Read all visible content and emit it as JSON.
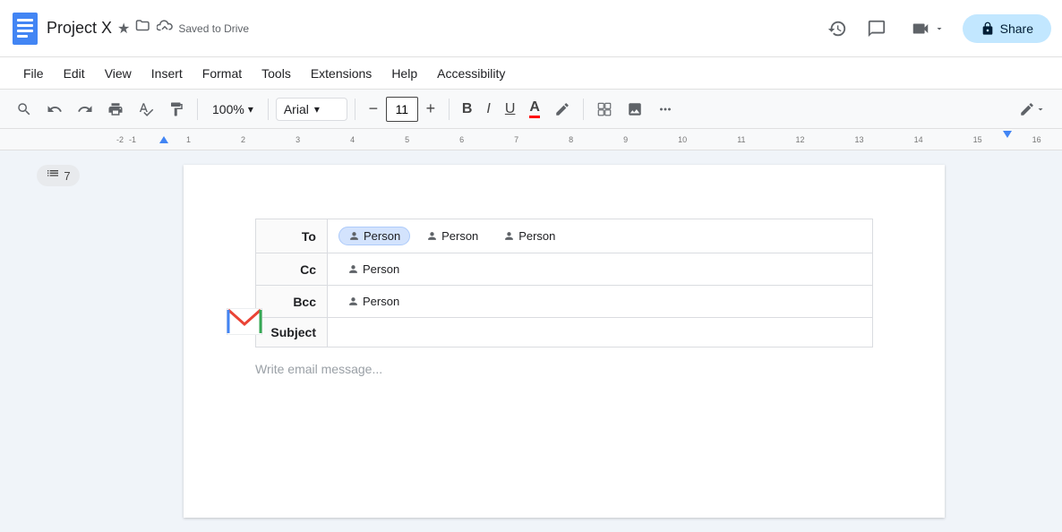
{
  "app": {
    "icon_label": "Google Docs",
    "title": "Project X",
    "saved_status": "Saved to Drive"
  },
  "top_bar": {
    "star_icon": "★",
    "folder_icon": "⊡",
    "cloud_icon": "☁",
    "history_icon": "⟳",
    "comment_icon": "💬",
    "video_icon": "📹",
    "video_label": "",
    "share_icon": "🔒",
    "share_label": "Share"
  },
  "menu": {
    "items": [
      "File",
      "Edit",
      "View",
      "Insert",
      "Format",
      "Tools",
      "Extensions",
      "Help",
      "Accessibility"
    ]
  },
  "toolbar": {
    "search_icon": "🔍",
    "undo_icon": "↩",
    "redo_icon": "↪",
    "print_icon": "🖨",
    "spellcheck_icon": "✓",
    "paint_format_icon": "🖌",
    "zoom_value": "100%",
    "zoom_dropdown": "▾",
    "font_name": "Arial",
    "font_dropdown": "▾",
    "font_minus": "−",
    "font_size": "11",
    "font_plus": "+",
    "bold": "B",
    "italic": "I",
    "underline": "U",
    "highlight": "A",
    "pen_icon": "✏",
    "insert_text_icon": "⊞",
    "insert_image_icon": "🖼",
    "more_icon": "⋯",
    "edit_mode_icon": "✏"
  },
  "outline": {
    "icon": "≡",
    "count": "7"
  },
  "email_table": {
    "to_label": "To",
    "to_persons": [
      "Person",
      "Person",
      "Person"
    ],
    "cc_label": "Cc",
    "cc_persons": [
      "Person"
    ],
    "bcc_label": "Bcc",
    "bcc_persons": [
      "Person"
    ],
    "subject_label": "Subject",
    "subject_value": ""
  },
  "compose": {
    "placeholder": "Write email message..."
  },
  "colors": {
    "accent_blue": "#4285f4",
    "chip_selected_bg": "#d3e3fd",
    "share_btn_bg": "#c2e7ff"
  }
}
